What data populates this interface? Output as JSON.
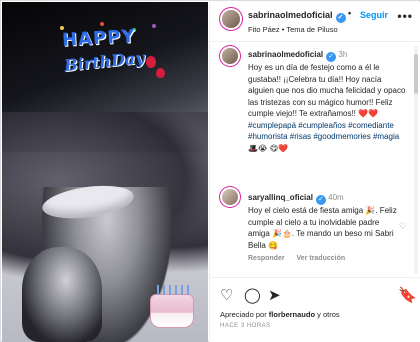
{
  "post": {
    "photo": {
      "overlay_line1": "HAPPY",
      "overlay_line2": "BirthDay"
    },
    "header": {
      "username": "sabrinaolmedoficial",
      "verified_glyph": "✓",
      "separator": "•",
      "follow_label": "Seguir",
      "subtitle": "Fito Páez • Tema de Piluso",
      "more_glyph": "•••"
    },
    "caption": {
      "username": "sabrinaolmedoficial",
      "verified_glyph": "✓",
      "time": "3h",
      "text": "Hoy es un día de festejo como a él le gustaba!! ¡¡Celebra tu día!! Hoy nacía alguien que nos dio mucha felicidad y opaco las tristezas con su mágico humor!! Feliz cumple viejo!! Te extrañamos!!",
      "text_emoji": "❤️❤️",
      "hashtags": "#cumplepapá #cumpleaños #comediante #humorista #risas #goodmemories #magia",
      "hashtags_emoji": "🎩😭 😋❤️"
    },
    "comments": [
      {
        "username": "saryallinq_oficial",
        "verified_glyph": "✓",
        "time": "40m",
        "text": "Hoy el cielo está de fiesta amiga 🎉. Feliz cumple al cielo a tu inolvidable padre amiga 🎉🎂. Te mando un beso mi Sabri Bella 😋",
        "reply_label": "Responder",
        "translate_label": "Ver traducción",
        "like_icon": "heart-outline-icon",
        "like_glyph": "♡"
      }
    ],
    "caption_actions": {
      "translate_label": "Ver traducción"
    },
    "bar": {
      "icons": [
        {
          "name": "heart-icon",
          "glyph": "♡"
        },
        {
          "name": "comment-icon",
          "glyph": "◯"
        },
        {
          "name": "share-icon",
          "glyph": "➤"
        },
        {
          "name": "bookmark-icon",
          "glyph": "🔖"
        }
      ],
      "likes_prefix": "Apreciado por",
      "likes_user": "florbernaudo",
      "likes_suffix": "y otros",
      "time_ago": "HACE 3 HORAS"
    }
  },
  "colors": {
    "accent": "#0095f6",
    "verified": "#3897f0",
    "hashtag": "#00376b",
    "secondary_text": "#8e8e8e",
    "overlay_text": "#2e6ce6"
  }
}
